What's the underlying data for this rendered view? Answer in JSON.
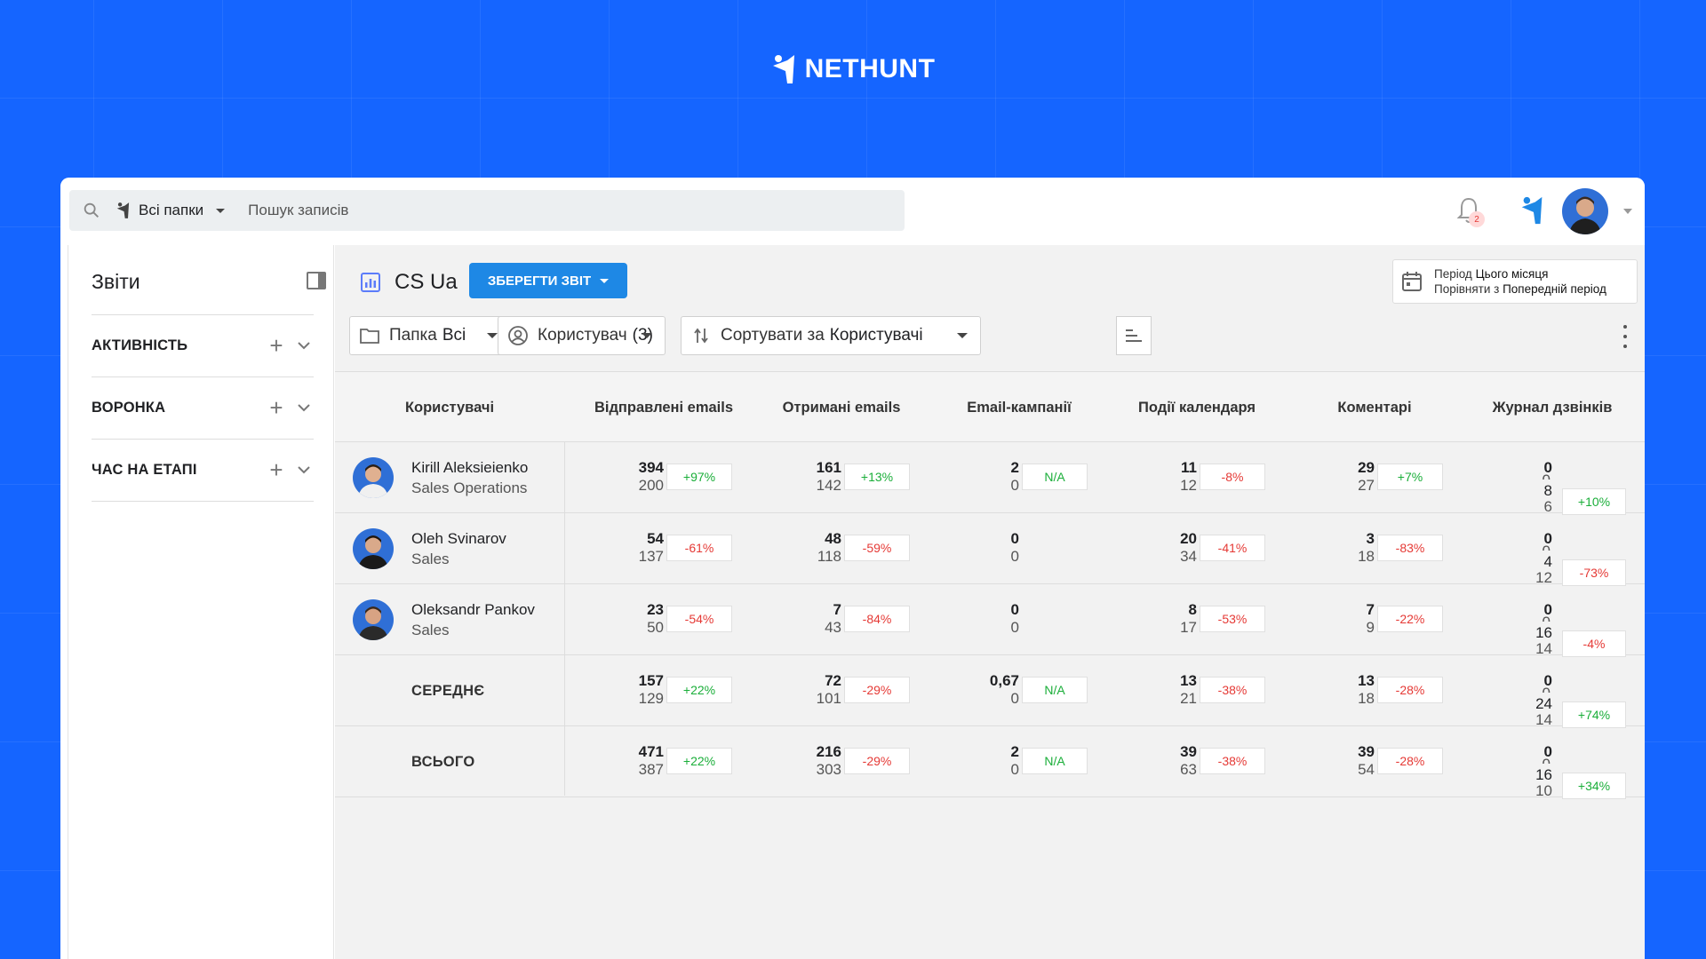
{
  "brand": {
    "name_big": "NET",
    "name_big2": "HUNT"
  },
  "search": {
    "folder": "Всі папки",
    "placeholder": "Пошук записів"
  },
  "notifications": {
    "count": "2"
  },
  "sidebar": {
    "title": "Звіти",
    "sections": [
      {
        "label": "АКТИВНІСТЬ"
      },
      {
        "label": "ВОРОНКА"
      },
      {
        "label": "ЧАС НА ЕТАПІ"
      }
    ]
  },
  "report": {
    "title": "CS Ua",
    "save_label": "ЗБЕРЕГТИ ЗВІТ",
    "period_label": "Період",
    "period_value": "Цього місяця",
    "compare_label": "Порівняти з",
    "compare_value": "Попередній період"
  },
  "filters": {
    "folder_label": "Папка",
    "folder_value": "Всі",
    "user_label": "Користувач",
    "user_value": "(3)",
    "sort_label": "Сортувати за",
    "sort_value": "Користувачі"
  },
  "table": {
    "headers": [
      "Користувачі",
      "Відправлені emails",
      "Отримані emails",
      "Email-кампанії",
      "Події календаря",
      "Коментарі",
      "Журнал дзвінків"
    ],
    "rows": [
      {
        "name": "Kirill Aleksieienko",
        "role": "Sales Operations",
        "cells": [
          {
            "cur": "394",
            "prev": "200",
            "delta": "+97%",
            "kind": "pos"
          },
          {
            "cur": "161",
            "prev": "142",
            "delta": "+13%",
            "kind": "pos"
          },
          {
            "cur": "2",
            "prev": "0",
            "delta": "N/A",
            "kind": "na"
          },
          {
            "cur": "11",
            "prev": "12",
            "delta": "-8%",
            "kind": "neg"
          },
          {
            "cur": "29",
            "prev": "27",
            "delta": "+7%",
            "kind": "pos"
          }
        ],
        "calls": {
          "cur": "0",
          "prev": "0",
          "cur2": "8",
          "prev2": "6",
          "delta": "+10%",
          "kind": "pos"
        }
      },
      {
        "name": "Oleh Svinarov",
        "role": "Sales",
        "cells": [
          {
            "cur": "54",
            "prev": "137",
            "delta": "-61%",
            "kind": "neg"
          },
          {
            "cur": "48",
            "prev": "118",
            "delta": "-59%",
            "kind": "neg"
          },
          {
            "cur": "0",
            "prev": "0",
            "delta": "",
            "kind": "none"
          },
          {
            "cur": "20",
            "prev": "34",
            "delta": "-41%",
            "kind": "neg"
          },
          {
            "cur": "3",
            "prev": "18",
            "delta": "-83%",
            "kind": "neg"
          }
        ],
        "calls": {
          "cur": "0",
          "prev": "0",
          "cur2": "4",
          "prev2": "12",
          "delta": "-73%",
          "kind": "neg"
        }
      },
      {
        "name": "Oleksandr Pankov",
        "role": "Sales",
        "cells": [
          {
            "cur": "23",
            "prev": "50",
            "delta": "-54%",
            "kind": "neg"
          },
          {
            "cur": "7",
            "prev": "43",
            "delta": "-84%",
            "kind": "neg"
          },
          {
            "cur": "0",
            "prev": "0",
            "delta": "",
            "kind": "none"
          },
          {
            "cur": "8",
            "prev": "17",
            "delta": "-53%",
            "kind": "neg"
          },
          {
            "cur": "7",
            "prev": "9",
            "delta": "-22%",
            "kind": "neg"
          }
        ],
        "calls": {
          "cur": "0",
          "prev": "0",
          "cur2": "16",
          "prev2": "14",
          "delta": "-4%",
          "kind": "neg"
        }
      },
      {
        "label": "СЕРЕДНЄ",
        "cells": [
          {
            "cur": "157",
            "prev": "129",
            "delta": "+22%",
            "kind": "pos"
          },
          {
            "cur": "72",
            "prev": "101",
            "delta": "-29%",
            "kind": "neg"
          },
          {
            "cur": "0,67",
            "prev": "0",
            "delta": "N/A",
            "kind": "na"
          },
          {
            "cur": "13",
            "prev": "21",
            "delta": "-38%",
            "kind": "neg"
          },
          {
            "cur": "13",
            "prev": "18",
            "delta": "-28%",
            "kind": "neg"
          }
        ],
        "calls": {
          "cur": "0",
          "prev": "0",
          "cur2": "24",
          "prev2": "14",
          "delta": "+74%",
          "kind": "pos"
        }
      },
      {
        "label": "ВСЬОГО",
        "cells": [
          {
            "cur": "471",
            "prev": "387",
            "delta": "+22%",
            "kind": "pos"
          },
          {
            "cur": "216",
            "prev": "303",
            "delta": "-29%",
            "kind": "neg"
          },
          {
            "cur": "2",
            "prev": "0",
            "delta": "N/A",
            "kind": "na"
          },
          {
            "cur": "39",
            "prev": "63",
            "delta": "-38%",
            "kind": "neg"
          },
          {
            "cur": "39",
            "prev": "54",
            "delta": "-28%",
            "kind": "neg"
          }
        ],
        "calls": {
          "cur": "0",
          "prev": "0",
          "cur2": "16",
          "prev2": "10",
          "delta": "+34%",
          "kind": "pos"
        }
      }
    ]
  },
  "colors": {
    "background": "#1565FF",
    "accent": "#1e88e5",
    "positive": "#1aae39",
    "negative": "#e53935"
  }
}
